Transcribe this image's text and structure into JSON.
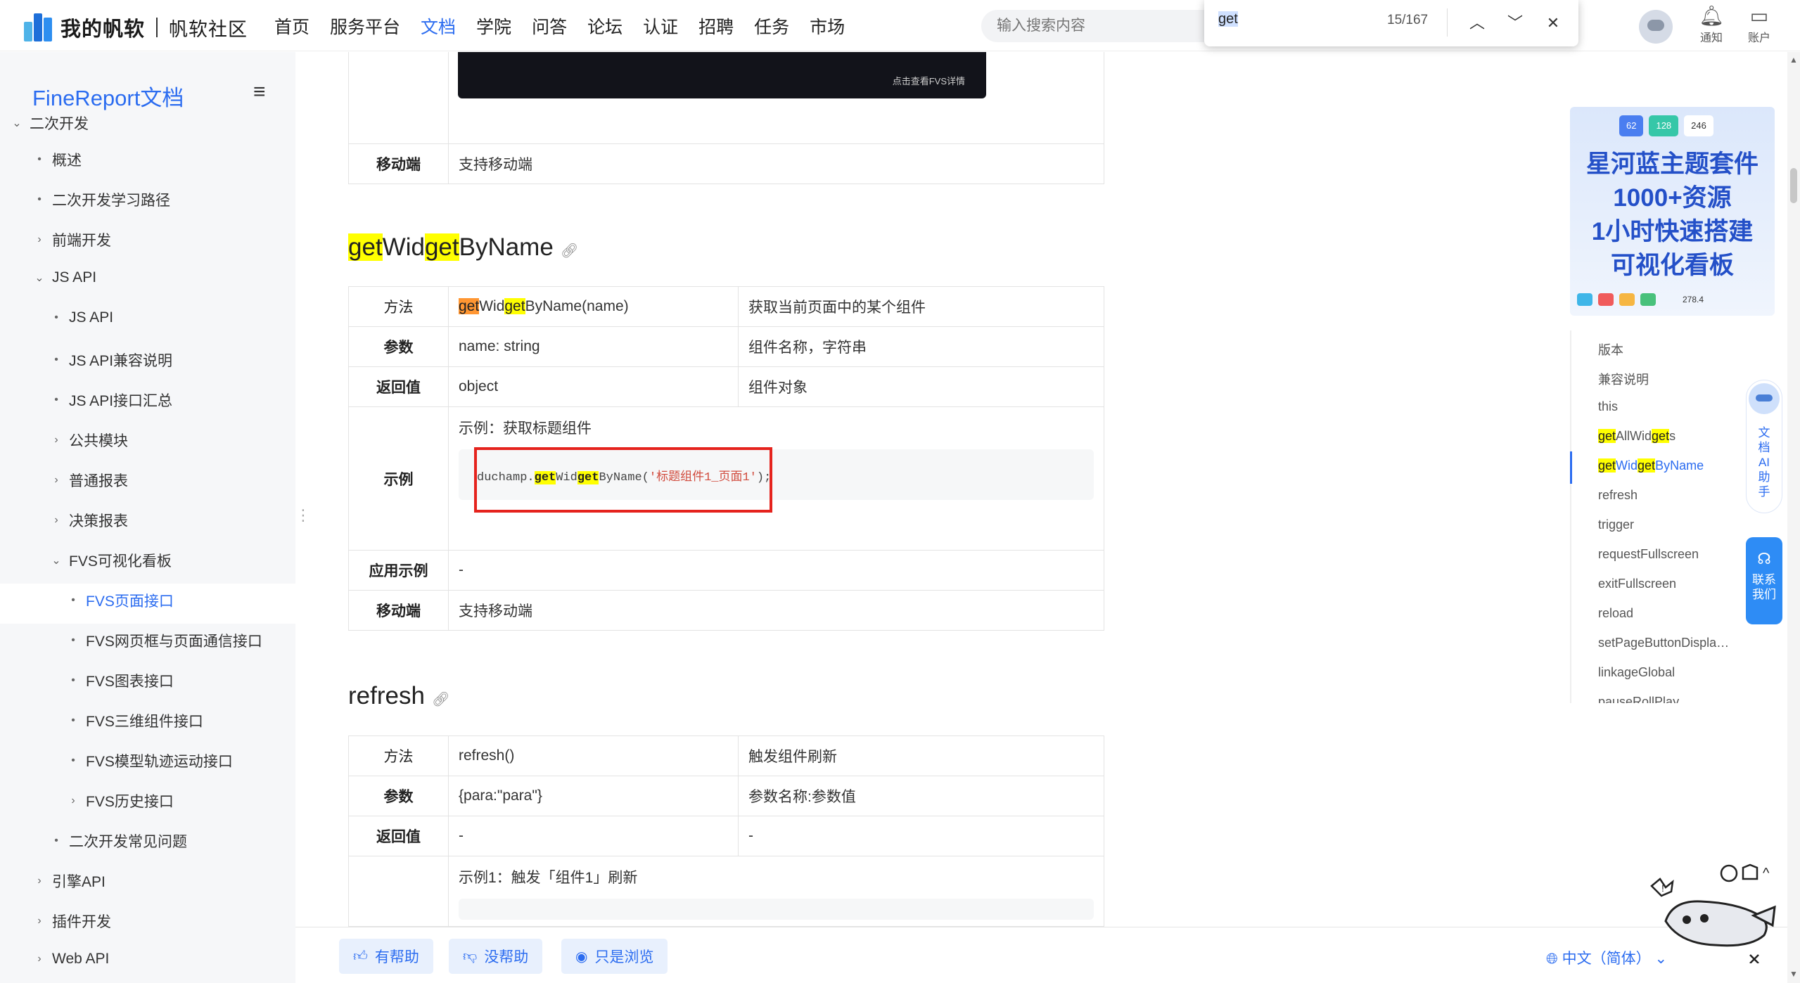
{
  "header": {
    "brand": "我的帆软",
    "community": "帆软社区",
    "nav": [
      "首页",
      "服务平台",
      "文档",
      "学院",
      "问答",
      "论坛",
      "认证",
      "招聘",
      "任务",
      "市场"
    ],
    "search_placeholder": "输入搜索内容",
    "notify_label": "通知",
    "account_label": "账户"
  },
  "findbar": {
    "query": "get",
    "count": "15/167"
  },
  "sidebar": {
    "title": "FineReport文档",
    "items": [
      {
        "label": "二次开发",
        "bullet": "⌄"
      },
      {
        "label": "概述",
        "bullet": "•"
      },
      {
        "label": "二次开发学习路径",
        "bullet": "•"
      },
      {
        "label": "前端开发",
        "bullet": "›"
      },
      {
        "label": "JS API",
        "bullet": "⌄"
      },
      {
        "label": "JS API",
        "bullet": "•"
      },
      {
        "label": "JS API兼容说明",
        "bullet": "•"
      },
      {
        "label": "JS API接口汇总",
        "bullet": "•"
      },
      {
        "label": "公共模块",
        "bullet": "›"
      },
      {
        "label": "普通报表",
        "bullet": "›"
      },
      {
        "label": "决策报表",
        "bullet": "›"
      },
      {
        "label": "FVS可视化看板",
        "bullet": "⌄"
      },
      {
        "label": "FVS页面接口",
        "bullet": "•"
      },
      {
        "label": "FVS网页框与页面通信接口",
        "bullet": "•"
      },
      {
        "label": "FVS图表接口",
        "bullet": "•"
      },
      {
        "label": "FVS三维组件接口",
        "bullet": "•"
      },
      {
        "label": "FVS模型轨迹运动接口",
        "bullet": "•"
      },
      {
        "label": "FVS历史接口",
        "bullet": "›"
      },
      {
        "label": "二次开发常见问题",
        "bullet": "•"
      },
      {
        "label": "引擎API",
        "bullet": "›"
      },
      {
        "label": "插件开发",
        "bullet": "›"
      },
      {
        "label": "Web API",
        "bullet": "›"
      }
    ]
  },
  "content": {
    "top_image_caption": "点击查看FVS详情",
    "mobile_label": "移动端",
    "mobile_value": "支持移动端",
    "getwidget": {
      "heading_parts": [
        "get",
        "Wid",
        "get",
        "ByName"
      ],
      "method_label": "方法",
      "method_parts": [
        "get",
        "Wid",
        "get",
        "ByName(name)"
      ],
      "method_desc": "获取当前页面中的某个组件",
      "param_label": "参数",
      "param_value": "name: string",
      "param_desc": "组件名称，字符串",
      "return_label": "返回值",
      "return_value": "object",
      "return_desc": "组件对象",
      "example_label": "示例",
      "example_caption": "示例：获取标题组件",
      "code_prefix": "duchamp.",
      "code_get1": "get",
      "code_wid": "Wid",
      "code_get2": "get",
      "code_suffix": "ByName(",
      "code_string": "'标题组件1_页面1'",
      "code_end": ");",
      "app_label": "应用示例",
      "app_value": "-",
      "mobile_label": "移动端",
      "mobile_value": "支持移动端"
    },
    "refresh": {
      "heading": "refresh",
      "method_label": "方法",
      "method_value": "refresh()",
      "method_desc": "触发组件刷新",
      "param_label": "参数",
      "param_value": "{para:\"para\"}",
      "param_desc": "参数名称:参数值",
      "return_label": "返回值",
      "return_value": "-",
      "return_desc": "-",
      "example_caption": "示例1：触发「组件1」刷新"
    }
  },
  "banner": {
    "stats": [
      "62",
      "128",
      "246"
    ],
    "lines": [
      "星河蓝主题套件",
      "1000+资源",
      "1小时快速搭建",
      "可视化看板"
    ],
    "value": "278.4"
  },
  "toc": {
    "items": [
      "版本",
      "兼容说明",
      "this",
      "getAllWidgets",
      "getWidgetByName",
      "refresh",
      "trigger",
      "requestFullscreen",
      "exitFullscreen",
      "reload",
      "setPageButtonDispla…",
      "linkageGlobal",
      "pauseRollPlay"
    ]
  },
  "assistant": {
    "ai_label": "文档AI助手",
    "contact_label": "联系我们"
  },
  "footer": {
    "helpful": "有帮助",
    "not_helpful": "没帮助",
    "just_browsing": "只是浏览",
    "language": "中文（简体）"
  },
  "colors": {
    "accent": "#2b6cf0",
    "highlight": "#ffff00",
    "current_highlight": "#ff9632",
    "annotation_red": "#e5231d"
  }
}
